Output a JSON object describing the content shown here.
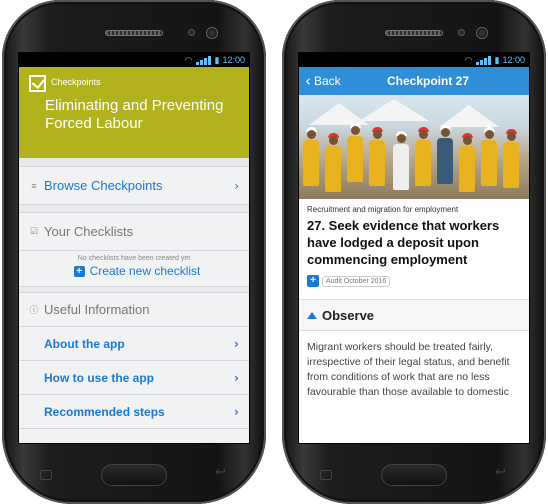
{
  "status": {
    "time": "12:00"
  },
  "left": {
    "brand": "Checkpoints",
    "title": "Eliminating and Preventing Forced Labour",
    "browse_label": "Browse Checkpoints",
    "checklists_label": "Your Checklists",
    "empty_note": "No checklists have been created yet",
    "create_label": "Create new checklist",
    "info_label": "Useful Information",
    "info_items": [
      {
        "label": "About the app"
      },
      {
        "label": "How to use the app"
      },
      {
        "label": "Recommended steps"
      }
    ]
  },
  "right": {
    "back_label": "Back",
    "title": "Checkpoint 27",
    "category": "Recruitment and migration for employment",
    "heading": "27. Seek evidence that workers have lodged a deposit upon commencing employment",
    "tag": "Audit October 2016",
    "observe_label": "Observe",
    "paragraph": "Migrant workers should be treated fairly, irrespective of their legal status, and benefit from conditions of work that are no less favourable than those available to domestic"
  },
  "colors": {
    "header_olive": "#b2b31c",
    "nav_blue": "#2f8ed8",
    "link_blue": "#1a78d6"
  },
  "icons": [
    "list-icon",
    "checkbox-icon",
    "info-icon",
    "chevron-right-icon",
    "plus-icon",
    "back-arrow-icon",
    "triangle-up-icon",
    "wifi-icon",
    "signal-icon",
    "battery-icon",
    "menu-key-icon",
    "back-key-icon"
  ]
}
